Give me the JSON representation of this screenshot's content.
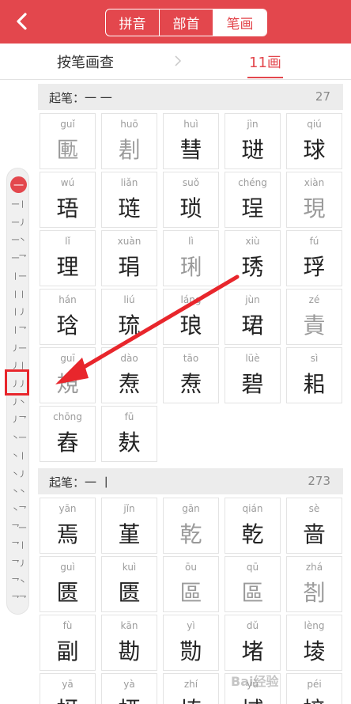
{
  "header": {
    "tabs": [
      {
        "label": "拼音",
        "active": false
      },
      {
        "label": "部首",
        "active": false
      },
      {
        "label": "笔画",
        "active": true
      }
    ]
  },
  "breadcrumb": {
    "first": "按笔画查",
    "second": "11画"
  },
  "rail": {
    "top": "一",
    "items": [
      "一丨",
      "一丿",
      "一丶",
      "一乛",
      "丨一",
      "丨丨",
      "丨丿",
      "丨乛",
      "丿一",
      "丿丨",
      "丿丿",
      "丿丶",
      "丿乛",
      "丶一",
      "丶丨",
      "丶丿",
      "丶丶",
      "丶乛",
      "乛一",
      "乛丨",
      "乛丿",
      "乛丶",
      "乛乛"
    ]
  },
  "sections": [
    {
      "title": "起笔：一 一",
      "count": "27",
      "chars": [
        {
          "py": "guǐ",
          "hz": "匭",
          "dim": true
        },
        {
          "py": "huō",
          "hz": "剨",
          "dim": true
        },
        {
          "py": "huì",
          "hz": "彗",
          "dim": false
        },
        {
          "py": "jìn",
          "hz": "琎",
          "dim": false
        },
        {
          "py": "qiú",
          "hz": "球",
          "dim": false
        },
        {
          "py": "wú",
          "hz": "珸",
          "dim": false
        },
        {
          "py": "liǎn",
          "hz": "琏",
          "dim": false
        },
        {
          "py": "suǒ",
          "hz": "琐",
          "dim": false
        },
        {
          "py": "chéng",
          "hz": "珵",
          "dim": false
        },
        {
          "py": "xiàn",
          "hz": "現",
          "dim": true
        },
        {
          "py": "lǐ",
          "hz": "理",
          "dim": false
        },
        {
          "py": "xuàn",
          "hz": "琄",
          "dim": false
        },
        {
          "py": "lì",
          "hz": "琍",
          "dim": true
        },
        {
          "py": "xiù",
          "hz": "琇",
          "dim": false
        },
        {
          "py": "fú",
          "hz": "琈",
          "dim": false
        },
        {
          "py": "hán",
          "hz": "琀",
          "dim": false
        },
        {
          "py": "liú",
          "hz": "琉",
          "dim": false
        },
        {
          "py": "láng",
          "hz": "琅",
          "dim": false
        },
        {
          "py": "jùn",
          "hz": "珺",
          "dim": false
        },
        {
          "py": "zé",
          "hz": "責",
          "dim": true
        },
        {
          "py": "guī",
          "hz": "規",
          "dim": true
        },
        {
          "py": "dào",
          "hz": "焘",
          "dim": false
        },
        {
          "py": "tāo",
          "hz": "焘",
          "dim": false
        },
        {
          "py": "lüè",
          "hz": "碧",
          "dim": false
        },
        {
          "py": "sì",
          "hz": "耜",
          "dim": false
        },
        {
          "py": "chōng",
          "hz": "舂",
          "dim": false
        },
        {
          "py": "fū",
          "hz": "麸",
          "dim": false
        }
      ]
    },
    {
      "title": "起笔：一 丨",
      "count": "273",
      "chars": [
        {
          "py": "yān",
          "hz": "焉",
          "dim": false
        },
        {
          "py": "jǐn",
          "hz": "堇",
          "dim": false
        },
        {
          "py": "gān",
          "hz": "乾",
          "dim": true
        },
        {
          "py": "qián",
          "hz": "乾",
          "dim": false
        },
        {
          "py": "sè",
          "hz": "啬",
          "dim": false
        },
        {
          "py": "guì",
          "hz": "匮",
          "dim": false
        },
        {
          "py": "kuì",
          "hz": "匮",
          "dim": false
        },
        {
          "py": "ōu",
          "hz": "區",
          "dim": true
        },
        {
          "py": "qū",
          "hz": "區",
          "dim": true
        },
        {
          "py": "zhá",
          "hz": "剳",
          "dim": true
        },
        {
          "py": "fù",
          "hz": "副",
          "dim": false
        },
        {
          "py": "kān",
          "hz": "勘",
          "dim": false
        },
        {
          "py": "yì",
          "hz": "勚",
          "dim": false
        },
        {
          "py": "dǔ",
          "hz": "堵",
          "dim": false
        },
        {
          "py": "lèng",
          "hz": "堎",
          "dim": false
        },
        {
          "py": "yā",
          "hz": "㧎",
          "dim": false
        },
        {
          "py": "yà",
          "hz": "掗",
          "dim": false
        },
        {
          "py": "zhí",
          "hz": "埴",
          "dim": false
        },
        {
          "py": "yù",
          "hz": "域",
          "dim": false
        },
        {
          "py": "péi",
          "hz": "掊",
          "dim": false
        }
      ]
    }
  ],
  "watermark": "Bai经验",
  "colors": {
    "accent": "#e3474d",
    "highlight": "#e8262c"
  }
}
